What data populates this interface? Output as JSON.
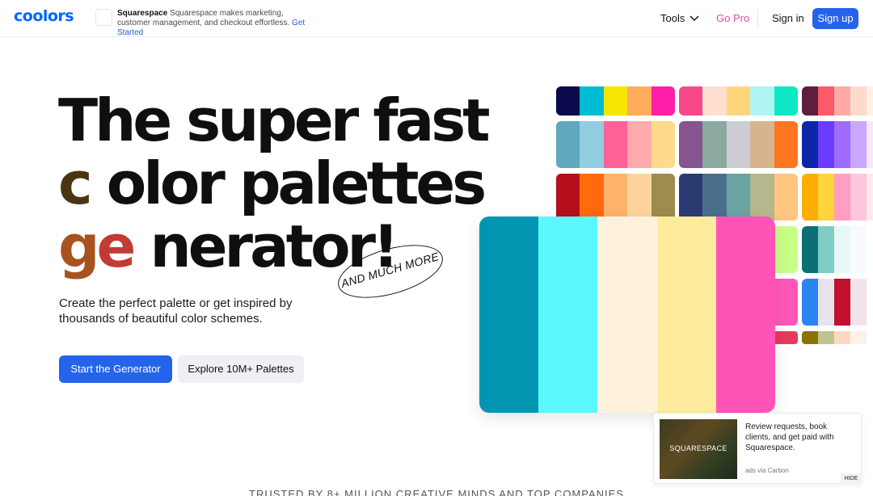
{
  "nav": {
    "logo": "coolors",
    "ad": {
      "brand": "Squarespace",
      "text": "Squarespace makes marketing, customer management, and checkout effortless.",
      "cta": "Get Started"
    },
    "tools_label": "Tools",
    "gopro_label": "Go Pro",
    "signin_label": "Sign in",
    "signup_label": "Sign up"
  },
  "hero": {
    "title_line1": "The super fast",
    "title_line2_highlight": "c",
    "title_line2_rest": "olor palettes",
    "title_line3_highlight_g": "g",
    "title_line3_highlight_e": "e",
    "title_line3_rest": "nerator!",
    "stamp": "AND MUCH MORE",
    "subtitle": "Create the perfect palette or get inspired by thousands of beautiful color schemes.",
    "primary_button": "Start the Generator",
    "secondary_button": "Explore 10M+ Palettes"
  },
  "palettes": [
    [
      "#0b0a4d",
      "#00bcd4",
      "#f5e500",
      "#ffad5a",
      "#ff1fa8"
    ],
    [
      "#f7498a",
      "#ffdfd0",
      "#ffd77a",
      "#aef5f4",
      "#0fe8c4"
    ],
    [
      "#5e1f3e",
      "#fb5a68",
      "#ffaaa6",
      "#ffd9c9",
      "#fff1e4"
    ],
    [
      "#5fa8bd",
      "#92cde0",
      "#ff6198",
      "#ffaaab",
      "#ffda8a"
    ],
    [
      "#86548f",
      "#8aaa9f",
      "#ccccd3",
      "#d6b58e",
      "#ff7621"
    ],
    [
      "#0a28a8",
      "#6a3cff",
      "#9d6cff",
      "#c9a7ff",
      "#f4e8ff"
    ],
    [
      "#b5101b",
      "#ff6a0d",
      "#ffb36b",
      "#ffd39e",
      "#9c8c4d"
    ],
    [
      "#2b3a73",
      "#4a6f8c",
      "#6aa4a3",
      "#b5b88c",
      "#ffc682"
    ],
    [
      "#ffae00",
      "#ffd43b",
      "#ff9ec0",
      "#ffc7dc",
      "#ffe8f0"
    ],
    [
      "#c8ff87",
      "#c8ff87",
      "#c8ff87",
      "#c8ff87",
      "#c8ff87"
    ],
    [
      "#0c6f73",
      "#7fcdc5",
      "#e9f8f6",
      "#f7fbfb",
      "#ffffff"
    ],
    [
      "#ff57b9",
      "#ff57b9",
      "#ff57b9",
      "#ff57b9",
      "#ff57b9"
    ],
    [
      "#2b84f0",
      "#e8e3ec",
      "#c3102e",
      "#f4e4ea",
      "#ffffff"
    ],
    [
      "#e63b5d",
      "#e63b5d",
      "#e63b5d",
      "#e63b5d",
      "#e63b5d"
    ],
    [
      "#8a7400",
      "#bec48b",
      "#fcd8c3",
      "#fff1e8",
      "#ffffff"
    ]
  ],
  "featured_palette": [
    "#0195b1",
    "#5bf8ff",
    "#fff2dd",
    "#ffeb9e",
    "#ff54b7"
  ],
  "carbon_ad": {
    "image_text": "SQUARESPACE",
    "copy": "Review requests, book clients, and get paid with Squarespace.",
    "via": "ads via Carbon",
    "hide_label": "HIDE"
  },
  "trusted_text": "TRUSTED BY 8+ MILLION CREATIVE MINDS AND TOP COMPANIES"
}
